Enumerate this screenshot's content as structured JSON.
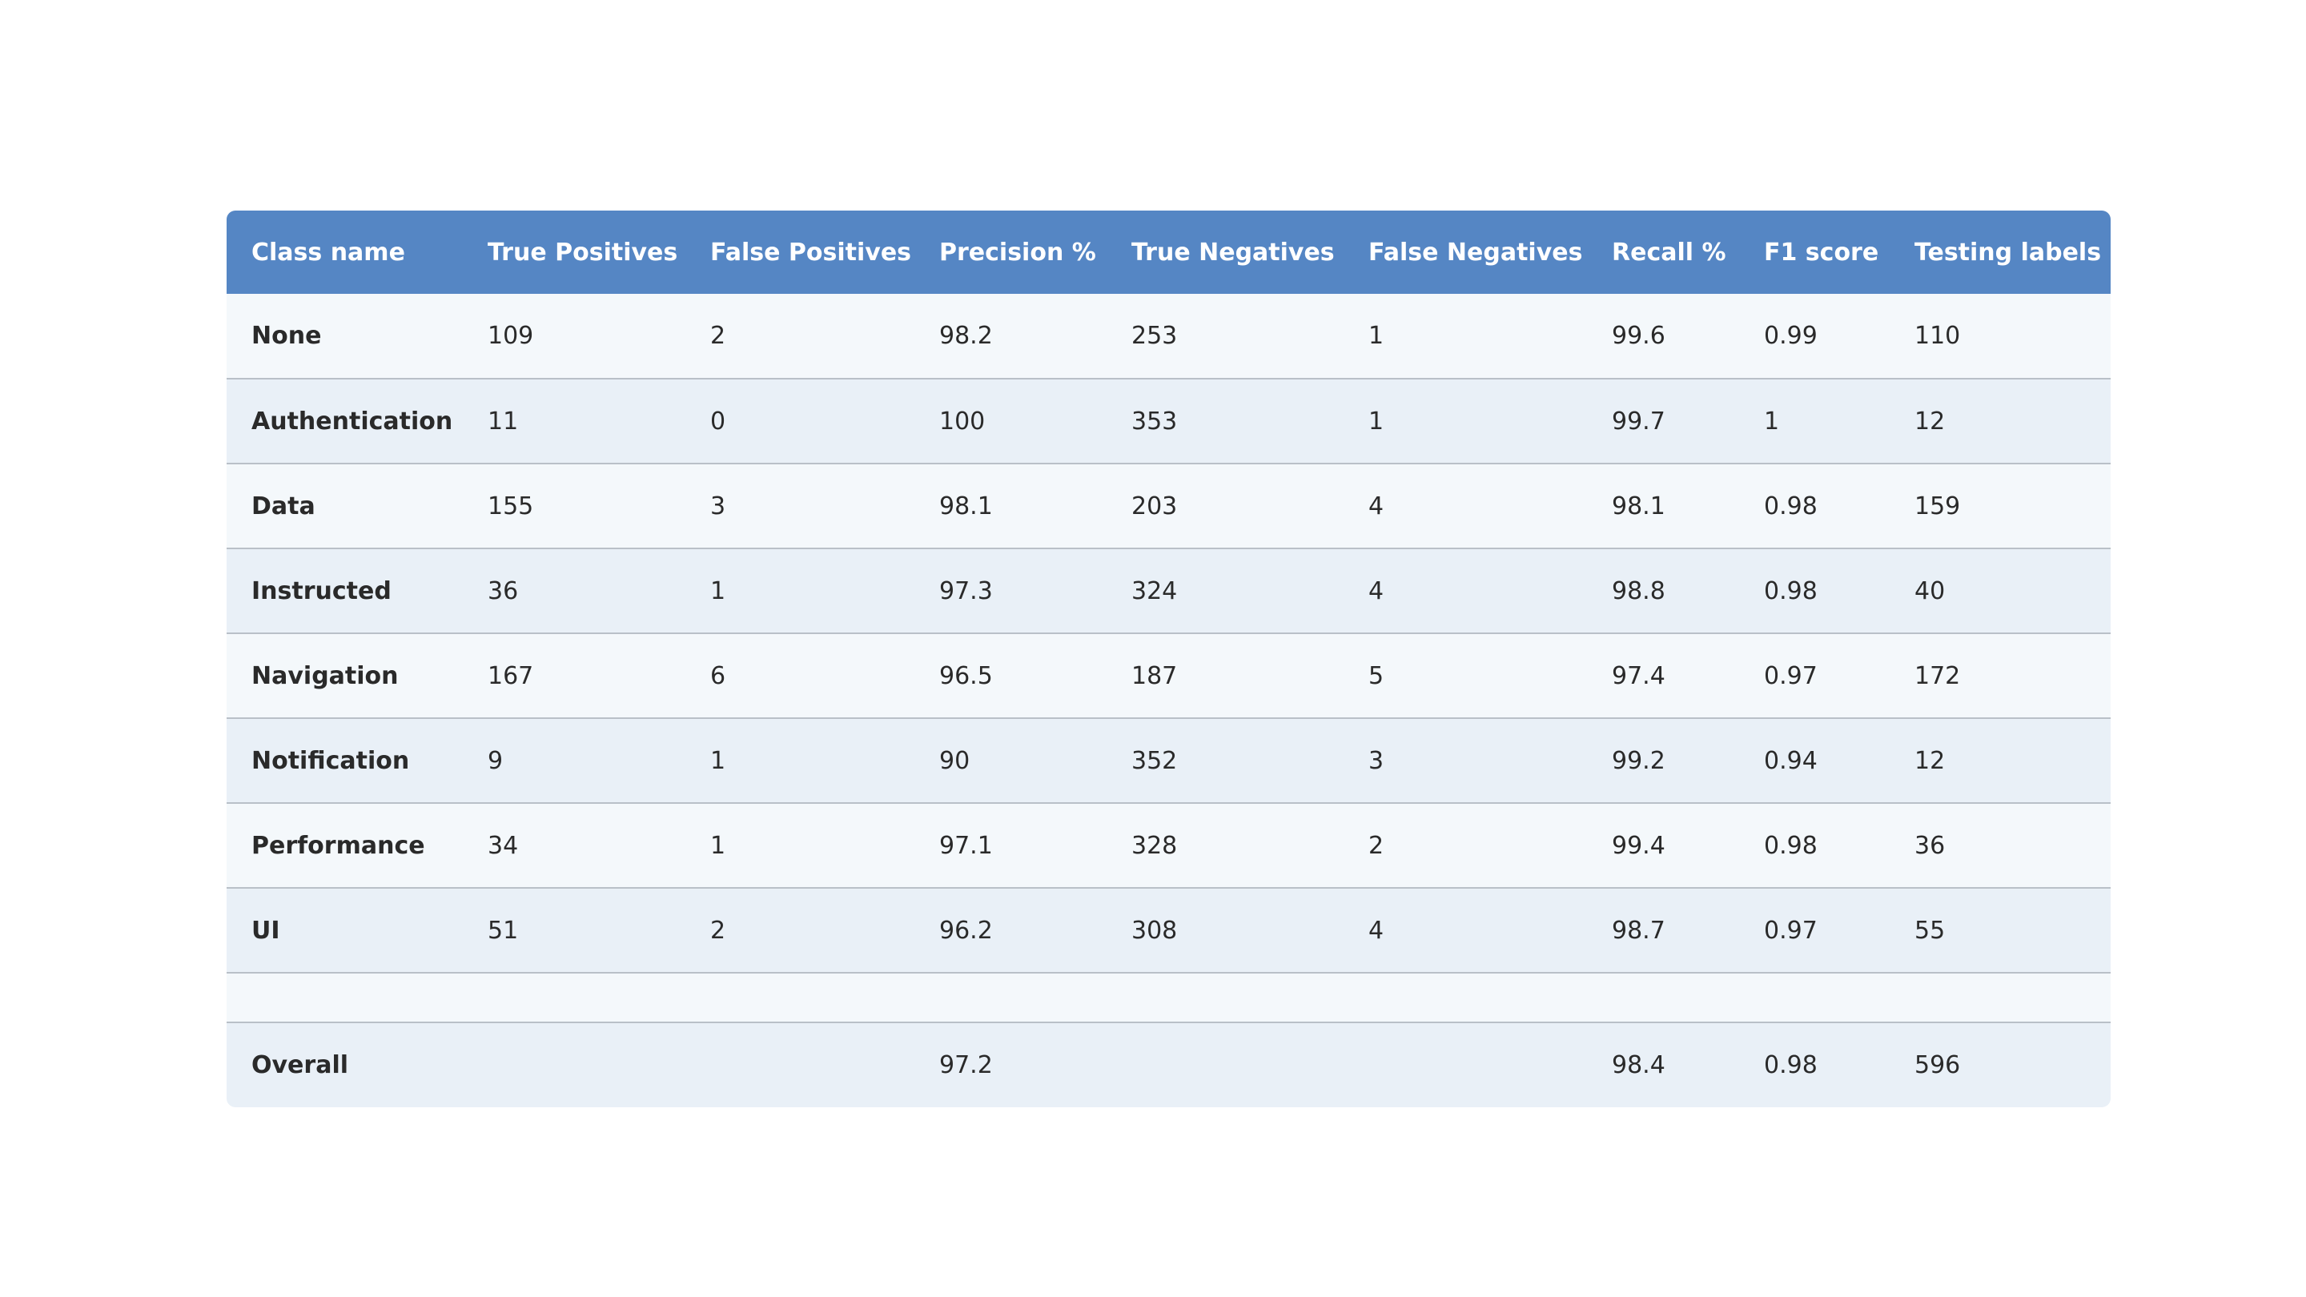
{
  "chart_data": {
    "type": "table",
    "columns": [
      "Class name",
      "True Positives",
      "False Positives",
      "Precision %",
      "True Negatives",
      "False Negatives",
      "Recall %",
      "F1 score",
      "Testing labels"
    ],
    "rows": [
      [
        "None",
        "109",
        "2",
        "98.2",
        "253",
        "1",
        "99.6",
        "0.99",
        "110"
      ],
      [
        "Authentication",
        "11",
        "0",
        "100",
        "353",
        "1",
        "99.7",
        "1",
        "12"
      ],
      [
        "Data",
        "155",
        "3",
        "98.1",
        "203",
        "4",
        "98.1",
        "0.98",
        "159"
      ],
      [
        "Instructed",
        "36",
        "1",
        "97.3",
        "324",
        "4",
        "98.8",
        "0.98",
        "40"
      ],
      [
        "Navigation",
        "167",
        "6",
        "96.5",
        "187",
        "5",
        "97.4",
        "0.97",
        "172"
      ],
      [
        "Notification",
        "9",
        "1",
        "90",
        "352",
        "3",
        "99.2",
        "0.94",
        "12"
      ],
      [
        "Performance",
        "34",
        "1",
        "97.1",
        "328",
        "2",
        "99.4",
        "0.98",
        "36"
      ],
      [
        "UI",
        "51",
        "2",
        "96.2",
        "308",
        "4",
        "98.7",
        "0.97",
        "55"
      ],
      [
        "",
        "",
        "",
        "",
        "",
        "",
        "",
        "",
        ""
      ],
      [
        "Overall",
        "",
        "",
        "97.2",
        "",
        "",
        "98.4",
        "0.98",
        "596"
      ]
    ],
    "colors": {
      "header_background": "#5586c4",
      "header_text": "#ffffff",
      "row_light": "#f4f8fb",
      "row_dark": "#e9f0f7",
      "divider": "#b9c0c8"
    }
  }
}
